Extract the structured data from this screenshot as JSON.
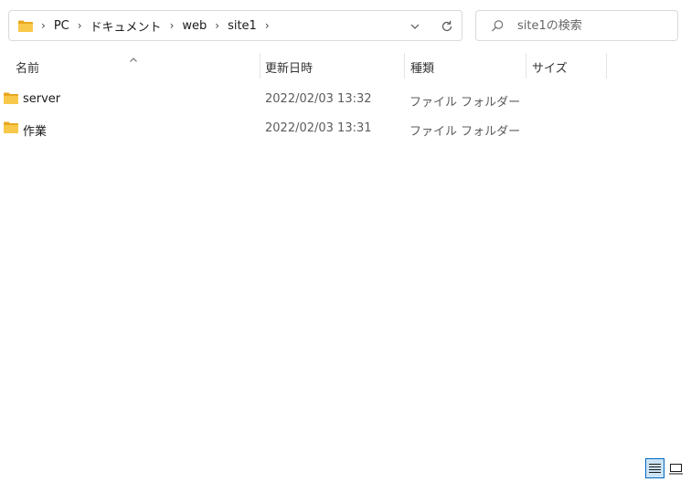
{
  "address_bar": {
    "breadcrumbs": [
      "PC",
      "ドキュメント",
      "web",
      "site1"
    ]
  },
  "search": {
    "placeholder": "site1の検索"
  },
  "columns": {
    "name": "名前",
    "modified": "更新日時",
    "type": "種類",
    "size": "サイズ"
  },
  "files": [
    {
      "name": "server",
      "modified": "2022/02/03 13:32",
      "type": "ファイル フォルダー",
      "size": ""
    },
    {
      "name": "作業",
      "modified": "2022/02/03 13:31",
      "type": "ファイル フォルダー",
      "size": ""
    }
  ],
  "colors": {
    "folder": "#f8c84a",
    "folder_dark": "#e8a820",
    "accent": "#0067c0"
  },
  "icons": [
    "folder-icon",
    "chevron-right-icon",
    "chevron-down-icon",
    "refresh-icon",
    "search-icon",
    "sort-up-icon",
    "details-view-icon",
    "tiles-view-icon"
  ]
}
